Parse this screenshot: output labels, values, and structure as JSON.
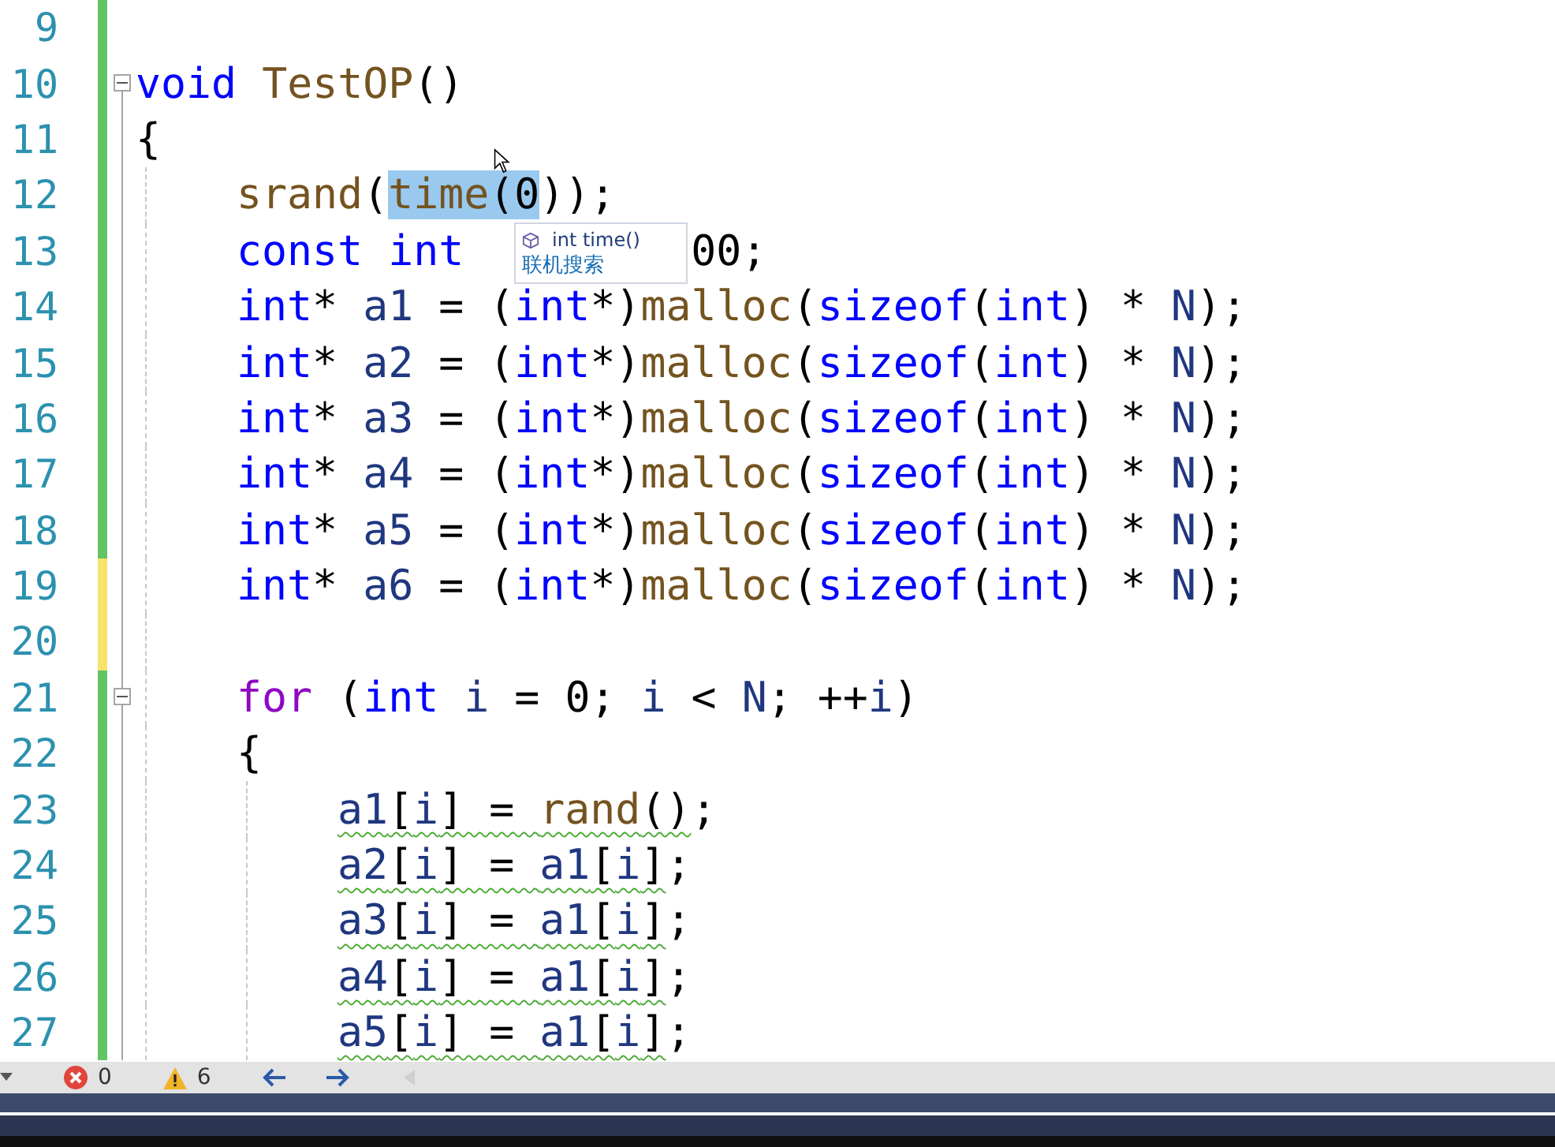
{
  "editor": {
    "lines": [
      {
        "number": "9",
        "saved": true,
        "foldable": false,
        "warning": false
      },
      {
        "number": "10",
        "saved": true,
        "foldable": true,
        "warning": false,
        "tokens": [
          {
            "kind": "keyword",
            "text": "void "
          },
          {
            "kind": "function",
            "text": "TestOP"
          },
          {
            "kind": "plain",
            "text": "()"
          }
        ]
      },
      {
        "number": "11",
        "saved": true,
        "foldable": false,
        "warning": false,
        "tokens": [
          {
            "kind": "plain",
            "text": "{"
          }
        ],
        "children": [
          {
            "number": "12",
            "saved": true,
            "foldable": false,
            "warning": false,
            "tokens": [
              {
                "kind": "function",
                "text": "srand",
                "highlighted": false
              },
              {
                "kind": "plain",
                "text": "(",
                "highlighted": false
              },
              {
                "kind": "function",
                "text": "time",
                "highlighted": true
              },
              {
                "kind": "plain",
                "text": "(",
                "highlighted": true
              },
              {
                "kind": "number",
                "text": "0",
                "highlighted": true
              },
              {
                "kind": "plain",
                "text": "));",
                "highlighted": false
              }
            ]
          },
          {
            "number": "13",
            "saved": true,
            "foldable": false,
            "warning": false,
            "tokens": [
              {
                "kind": "keyword",
                "text": "const "
              },
              {
                "kind": "keyword",
                "text": "int"
              },
              {
                "kind": "number",
                "text": "00"
              },
              {
                "kind": "plain",
                "text": ";"
              }
            ]
          },
          {
            "number": "14",
            "saved": true,
            "foldable": false,
            "warning": false,
            "tokens": [
              {
                "kind": "keyword",
                "text": "int"
              },
              {
                "kind": "plain",
                "text": "* "
              },
              {
                "kind": "variable",
                "text": "a1"
              },
              {
                "kind": "plain",
                "text": " = ("
              },
              {
                "kind": "keyword",
                "text": "int"
              },
              {
                "kind": "plain",
                "text": "*)"
              },
              {
                "kind": "function",
                "text": "malloc"
              },
              {
                "kind": "plain",
                "text": "("
              },
              {
                "kind": "keyword",
                "text": "sizeof"
              },
              {
                "kind": "plain",
                "text": "("
              },
              {
                "kind": "keyword",
                "text": "int"
              },
              {
                "kind": "plain",
                "text": ") * "
              },
              {
                "kind": "variable",
                "text": "N"
              },
              {
                "kind": "plain",
                "text": ");"
              }
            ]
          },
          {
            "number": "15",
            "saved": true,
            "foldable": false,
            "warning": false,
            "tokens": [
              {
                "kind": "keyword",
                "text": "int"
              },
              {
                "kind": "plain",
                "text": "* "
              },
              {
                "kind": "variable",
                "text": "a2"
              },
              {
                "kind": "plain",
                "text": " = ("
              },
              {
                "kind": "keyword",
                "text": "int"
              },
              {
                "kind": "plain",
                "text": "*)"
              },
              {
                "kind": "function",
                "text": "malloc"
              },
              {
                "kind": "plain",
                "text": "("
              },
              {
                "kind": "keyword",
                "text": "sizeof"
              },
              {
                "kind": "plain",
                "text": "("
              },
              {
                "kind": "keyword",
                "text": "int"
              },
              {
                "kind": "plain",
                "text": ") * "
              },
              {
                "kind": "variable",
                "text": "N"
              },
              {
                "kind": "plain",
                "text": ");"
              }
            ]
          },
          {
            "number": "16",
            "saved": true,
            "foldable": false,
            "warning": false,
            "tokens": [
              {
                "kind": "keyword",
                "text": "int"
              },
              {
                "kind": "plain",
                "text": "* "
              },
              {
                "kind": "variable",
                "text": "a3"
              },
              {
                "kind": "plain",
                "text": " = ("
              },
              {
                "kind": "keyword",
                "text": "int"
              },
              {
                "kind": "plain",
                "text": "*)"
              },
              {
                "kind": "function",
                "text": "malloc"
              },
              {
                "kind": "plain",
                "text": "("
              },
              {
                "kind": "keyword",
                "text": "sizeof"
              },
              {
                "kind": "plain",
                "text": "("
              },
              {
                "kind": "keyword",
                "text": "int"
              },
              {
                "kind": "plain",
                "text": ") * "
              },
              {
                "kind": "variable",
                "text": "N"
              },
              {
                "kind": "plain",
                "text": ");"
              }
            ]
          },
          {
            "number": "17",
            "saved": true,
            "foldable": false,
            "warning": false,
            "tokens": [
              {
                "kind": "keyword",
                "text": "int"
              },
              {
                "kind": "plain",
                "text": "* "
              },
              {
                "kind": "variable",
                "text": "a4"
              },
              {
                "kind": "plain",
                "text": " = ("
              },
              {
                "kind": "keyword",
                "text": "int"
              },
              {
                "kind": "plain",
                "text": "*)"
              },
              {
                "kind": "function",
                "text": "malloc"
              },
              {
                "kind": "plain",
                "text": "("
              },
              {
                "kind": "keyword",
                "text": "sizeof"
              },
              {
                "kind": "plain",
                "text": "("
              },
              {
                "kind": "keyword",
                "text": "int"
              },
              {
                "kind": "plain",
                "text": ") * "
              },
              {
                "kind": "variable",
                "text": "N"
              },
              {
                "kind": "plain",
                "text": ");"
              }
            ]
          },
          {
            "number": "18",
            "saved": true,
            "foldable": false,
            "warning": false,
            "tokens": [
              {
                "kind": "keyword",
                "text": "int"
              },
              {
                "kind": "plain",
                "text": "* "
              },
              {
                "kind": "variable",
                "text": "a5"
              },
              {
                "kind": "plain",
                "text": " = ("
              },
              {
                "kind": "keyword",
                "text": "int"
              },
              {
                "kind": "plain",
                "text": "*)"
              },
              {
                "kind": "function",
                "text": "malloc"
              },
              {
                "kind": "plain",
                "text": "("
              },
              {
                "kind": "keyword",
                "text": "sizeof"
              },
              {
                "kind": "plain",
                "text": "("
              },
              {
                "kind": "keyword",
                "text": "int"
              },
              {
                "kind": "plain",
                "text": ") * "
              },
              {
                "kind": "variable",
                "text": "N"
              },
              {
                "kind": "plain",
                "text": ");"
              }
            ]
          },
          {
            "number": "19",
            "saved": false,
            "foldable": false,
            "warning": false,
            "tokens": [
              {
                "kind": "keyword",
                "text": "int"
              },
              {
                "kind": "plain",
                "text": "* "
              },
              {
                "kind": "variable",
                "text": "a6"
              },
              {
                "kind": "plain",
                "text": " = ("
              },
              {
                "kind": "keyword",
                "text": "int"
              },
              {
                "kind": "plain",
                "text": "*)"
              },
              {
                "kind": "function",
                "text": "malloc"
              },
              {
                "kind": "plain",
                "text": "("
              },
              {
                "kind": "keyword",
                "text": "sizeof"
              },
              {
                "kind": "plain",
                "text": "("
              },
              {
                "kind": "keyword",
                "text": "int"
              },
              {
                "kind": "plain",
                "text": ") * "
              },
              {
                "kind": "variable",
                "text": "N"
              },
              {
                "kind": "plain",
                "text": ");"
              }
            ]
          },
          {
            "number": "20",
            "saved": false,
            "foldable": false,
            "warning": false
          },
          {
            "number": "21",
            "saved": true,
            "foldable": true,
            "warning": false,
            "tokens": [
              {
                "kind": "control",
                "text": "for"
              },
              {
                "kind": "plain",
                "text": " ("
              },
              {
                "kind": "keyword",
                "text": "int"
              },
              {
                "kind": "variable",
                "text": " i"
              },
              {
                "kind": "plain",
                "text": " = "
              },
              {
                "kind": "number",
                "text": "0"
              },
              {
                "kind": "plain",
                "text": "; "
              },
              {
                "kind": "variable",
                "text": "i"
              },
              {
                "kind": "plain",
                "text": " < "
              },
              {
                "kind": "variable",
                "text": "N"
              },
              {
                "kind": "plain",
                "text": "; ++"
              },
              {
                "kind": "variable",
                "text": "i"
              },
              {
                "kind": "plain",
                "text": ")"
              }
            ]
          },
          {
            "number": "22",
            "saved": true,
            "foldable": false,
            "warning": false,
            "tokens": [
              {
                "kind": "plain",
                "text": "{"
              }
            ],
            "children": [
              {
                "number": "23",
                "saved": true,
                "foldable": false,
                "warning": true,
                "tokens": [
                  {
                    "kind": "variable",
                    "text": "a1"
                  },
                  {
                    "kind": "plain",
                    "text": "["
                  },
                  {
                    "kind": "variable",
                    "text": "i"
                  },
                  {
                    "kind": "plain",
                    "text": "] = "
                  },
                  {
                    "kind": "function",
                    "text": "rand"
                  },
                  {
                    "kind": "plain",
                    "text": "()"
                  },
                  {
                    "kind": "plain",
                    "text": ";"
                  }
                ]
              },
              {
                "number": "24",
                "saved": true,
                "foldable": false,
                "warning": true,
                "tokens": [
                  {
                    "kind": "variable",
                    "text": "a2"
                  },
                  {
                    "kind": "plain",
                    "text": "["
                  },
                  {
                    "kind": "variable",
                    "text": "i"
                  },
                  {
                    "kind": "plain",
                    "text": "] = "
                  },
                  {
                    "kind": "variable",
                    "text": "a1"
                  },
                  {
                    "kind": "plain",
                    "text": "["
                  },
                  {
                    "kind": "variable",
                    "text": "i"
                  },
                  {
                    "kind": "plain",
                    "text": "]"
                  },
                  {
                    "kind": "plain",
                    "text": ";"
                  }
                ]
              },
              {
                "number": "25",
                "saved": true,
                "foldable": false,
                "warning": true,
                "tokens": [
                  {
                    "kind": "variable",
                    "text": "a3"
                  },
                  {
                    "kind": "plain",
                    "text": "["
                  },
                  {
                    "kind": "variable",
                    "text": "i"
                  },
                  {
                    "kind": "plain",
                    "text": "] = "
                  },
                  {
                    "kind": "variable",
                    "text": "a1"
                  },
                  {
                    "kind": "plain",
                    "text": "["
                  },
                  {
                    "kind": "variable",
                    "text": "i"
                  },
                  {
                    "kind": "plain",
                    "text": "]"
                  },
                  {
                    "kind": "plain",
                    "text": ";"
                  }
                ]
              },
              {
                "number": "26",
                "saved": true,
                "foldable": false,
                "warning": true,
                "tokens": [
                  {
                    "kind": "variable",
                    "text": "a4"
                  },
                  {
                    "kind": "plain",
                    "text": "["
                  },
                  {
                    "kind": "variable",
                    "text": "i"
                  },
                  {
                    "kind": "plain",
                    "text": "] = "
                  },
                  {
                    "kind": "variable",
                    "text": "a1"
                  },
                  {
                    "kind": "plain",
                    "text": "["
                  },
                  {
                    "kind": "variable",
                    "text": "i"
                  },
                  {
                    "kind": "plain",
                    "text": "]"
                  },
                  {
                    "kind": "plain",
                    "text": ";"
                  }
                ]
              },
              {
                "number": "27",
                "saved": true,
                "foldable": false,
                "warning": true,
                "tokens": [
                  {
                    "kind": "variable",
                    "text": "a5"
                  },
                  {
                    "kind": "plain",
                    "text": "["
                  },
                  {
                    "kind": "variable",
                    "text": "i"
                  },
                  {
                    "kind": "plain",
                    "text": "] = "
                  },
                  {
                    "kind": "variable",
                    "text": "a1"
                  },
                  {
                    "kind": "plain",
                    "text": "["
                  },
                  {
                    "kind": "variable",
                    "text": "i"
                  },
                  {
                    "kind": "plain",
                    "text": "]"
                  },
                  {
                    "kind": "plain",
                    "text": ";"
                  }
                ]
              }
            ]
          }
        ]
      }
    ]
  },
  "tooltip": {
    "rows": [
      {
        "kind": "signature",
        "text": "int time()"
      },
      {
        "kind": "link",
        "text": "联机搜索"
      }
    ]
  },
  "status_bar": {
    "errors": "0",
    "warnings": "6"
  }
}
